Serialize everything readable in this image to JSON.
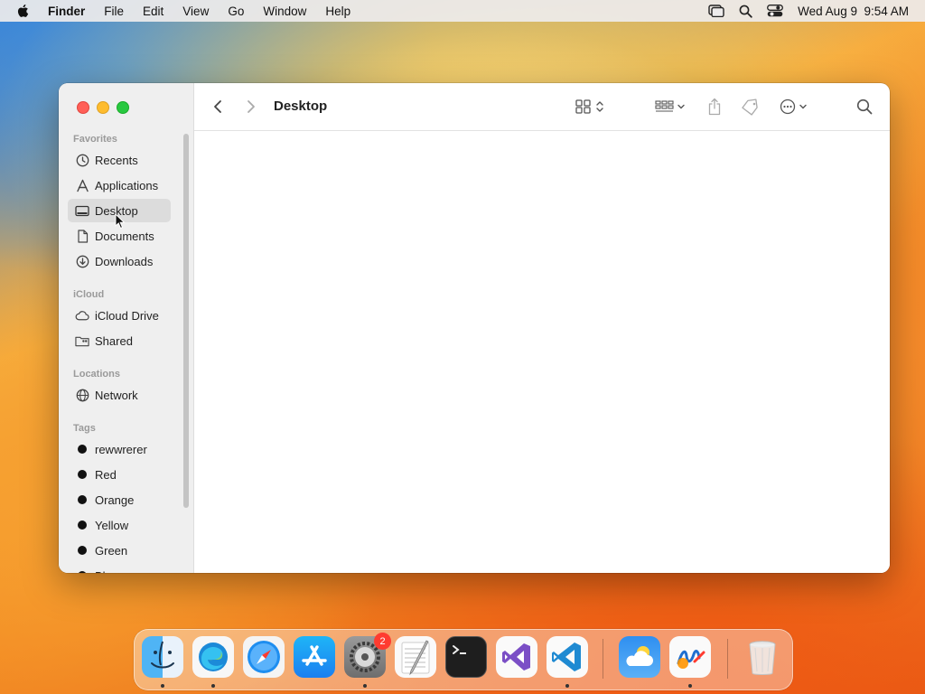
{
  "menubar": {
    "app_name": "Finder",
    "menus": [
      "File",
      "Edit",
      "View",
      "Go",
      "Window",
      "Help"
    ],
    "clock": "Wed Aug 9  9:54 AM",
    "status_icons": [
      "screen-mirroring-icon",
      "spotlight-search-icon",
      "control-center-icon"
    ]
  },
  "window": {
    "title": "Desktop",
    "toolbar_icons": [
      "back-chevron-icon",
      "forward-chevron-icon",
      "view-grid-icon",
      "group-by-icon",
      "share-icon",
      "tag-icon",
      "more-actions-icon",
      "search-icon"
    ]
  },
  "sidebar": {
    "sections": {
      "favorites": "Favorites",
      "icloud": "iCloud",
      "locations": "Locations",
      "tags": "Tags"
    },
    "favorites": [
      {
        "label": "Recents",
        "icon": "clock-icon"
      },
      {
        "label": "Applications",
        "icon": "applications-icon"
      },
      {
        "label": "Desktop",
        "icon": "desktop-icon",
        "selected": true
      },
      {
        "label": "Documents",
        "icon": "document-icon"
      },
      {
        "label": "Downloads",
        "icon": "download-icon"
      }
    ],
    "icloud": [
      {
        "label": "iCloud Drive",
        "icon": "cloud-icon"
      },
      {
        "label": "Shared",
        "icon": "shared-folder-icon"
      }
    ],
    "locations": [
      {
        "label": "Network",
        "icon": "globe-icon"
      }
    ],
    "tags": [
      {
        "label": "rewwrerer"
      },
      {
        "label": "Red"
      },
      {
        "label": "Orange"
      },
      {
        "label": "Yellow"
      },
      {
        "label": "Green"
      },
      {
        "label": "Bl"
      }
    ]
  },
  "dock": {
    "apps": [
      {
        "name": "finder-icon",
        "running": true
      },
      {
        "name": "edge-icon",
        "running": true
      },
      {
        "name": "safari-icon",
        "running": false
      },
      {
        "name": "app-store-icon",
        "running": false
      },
      {
        "name": "system-settings-icon",
        "running": true,
        "badge": "2"
      },
      {
        "name": "textedit-icon",
        "running": false
      },
      {
        "name": "terminal-icon",
        "running": false
      },
      {
        "name": "visual-studio-icon",
        "running": false
      },
      {
        "name": "vscode-icon",
        "running": true
      },
      {
        "name": "weather-icon",
        "running": false
      },
      {
        "name": "freeform-icon",
        "running": true
      },
      {
        "name": "trash-icon",
        "running": false
      }
    ]
  },
  "colors": {
    "close": "#ff5f57",
    "minimize": "#febc2e",
    "maximize": "#28c840",
    "sidebar_selected": "#dcdcdc",
    "badge": "#ff3b30"
  }
}
